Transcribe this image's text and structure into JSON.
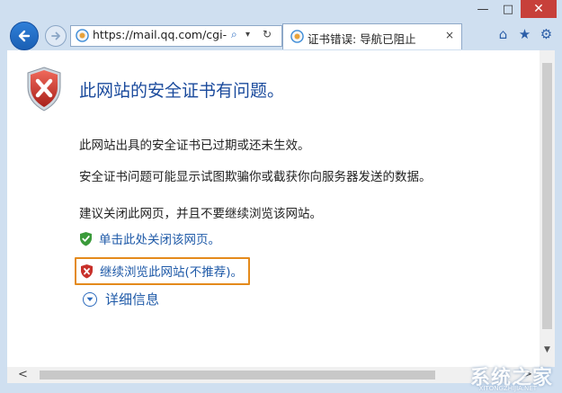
{
  "browser": {
    "url": "https://mail.qq.com/cgi-bi",
    "tab_title": "证书错误: 导航已阻止",
    "tab_close": "×",
    "search_glyph": "⌕",
    "refresh_glyph": "↻",
    "dropdown_glyph": "▾",
    "caption": {
      "minimize": "—",
      "maximize": "□",
      "close": "✕"
    },
    "tools": {
      "home": "⌂",
      "favorites": "★",
      "settings": "⚙"
    }
  },
  "page": {
    "heading": "此网站的安全证书有问题。",
    "paragraphs": [
      "此网站出具的安全证书已过期或还未生效。",
      "安全证书问题可能显示试图欺骗你或截获你向服务器发送的数据。",
      "建议关闭此网页，并且不要继续浏览该网站。"
    ],
    "close_link": "单击此处关闭该网页。",
    "continue_link": "继续浏览此网站(不推荐)。",
    "details_link": "详细信息"
  },
  "colors": {
    "heading": "#1a4a9c",
    "link": "#1f5aa8",
    "highlight_border": "#e48a1c",
    "danger": "#c8302a",
    "safe": "#3a9a3a"
  },
  "watermark": {
    "text": "系统之家",
    "sub": "XITONGZHIJIA.NET"
  }
}
